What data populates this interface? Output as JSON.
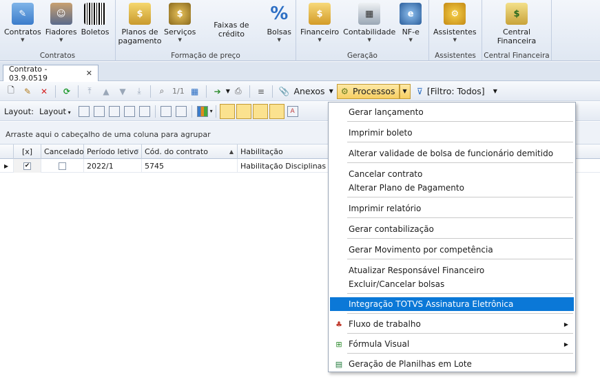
{
  "ribbon": {
    "groups": [
      {
        "label": "Contratos",
        "buttons": [
          {
            "label": "Contratos",
            "icon": "contract-icon",
            "dropdown": true
          },
          {
            "label": "Fiadores",
            "icon": "guarantor-icon",
            "dropdown": true
          },
          {
            "label": "Boletos",
            "icon": "barcode-icon",
            "dropdown": false
          }
        ]
      },
      {
        "label": "Formação de preço",
        "buttons": [
          {
            "label": "Planos de pagamento",
            "icon": "payment-plan-icon",
            "dropdown": false
          },
          {
            "label": "Serviços",
            "icon": "money-bag-icon",
            "dropdown": true
          },
          {
            "label": "Faixas de crédito",
            "icon": "",
            "dropdown": false
          },
          {
            "label": "Bolsas",
            "icon": "percent-icon",
            "dropdown": true
          }
        ]
      },
      {
        "label": "Geração",
        "buttons": [
          {
            "label": "Financeiro",
            "icon": "cash-icon",
            "dropdown": true
          },
          {
            "label": "Contabilidade",
            "icon": "ledger-icon",
            "dropdown": true
          },
          {
            "label": "NF-e",
            "icon": "nfe-icon",
            "dropdown": true
          }
        ]
      },
      {
        "label": "Assistentes",
        "buttons": [
          {
            "label": "Assistentes",
            "icon": "gears-icon",
            "dropdown": true
          }
        ]
      },
      {
        "label": "Central Financeira",
        "buttons": [
          {
            "label": "Central Financeira",
            "icon": "finance-folder-icon",
            "dropdown": false
          }
        ]
      }
    ]
  },
  "tab": {
    "title": "Contrato - 03.9.0519",
    "close": "✕"
  },
  "toolbar": {
    "record_nav": "1/1",
    "anexos": "Anexos",
    "processos": "Processos",
    "filtro": "[Filtro: Todos]"
  },
  "toolbar2": {
    "layout_label": "Layout:",
    "layout_btn": "Layout"
  },
  "group_panel": "Arraste aqui o cabeçalho de uma coluna para agrupar",
  "grid": {
    "columns": [
      "[x]",
      "Cancelado",
      "Período letivo",
      "Cód. do contrato",
      "Habilitação"
    ],
    "rows": [
      {
        "selected": true,
        "cancelado": false,
        "periodo": "2022/1",
        "codigo": "5745",
        "habilitacao": "Habilitação Disciplinas Créd"
      }
    ]
  },
  "menu": {
    "items": [
      {
        "label": "Gerar lançamento"
      },
      {
        "label": "Imprimir boleto"
      },
      {
        "label": "Alterar validade de bolsa de funcionário demitido"
      },
      {
        "label": "Cancelar contrato"
      },
      {
        "label": "Alterar Plano de Pagamento"
      },
      {
        "label": "Imprimir relatório"
      },
      {
        "label": "Gerar contabilização"
      },
      {
        "label": "Gerar Movimento por competência"
      },
      {
        "label": "Atualizar Responsável Financeiro"
      },
      {
        "label": "Excluir/Cancelar bolsas"
      },
      {
        "label": "Integração TOTVS Assinatura Eletrônica",
        "highlighted": true
      },
      {
        "label": "Fluxo de trabalho",
        "icon": "workflow-icon",
        "submenu": true
      },
      {
        "label": "Fórmula Visual",
        "icon": "formula-visual-icon",
        "submenu": true
      },
      {
        "label": "Geração de Planilhas em Lote",
        "icon": "spreadsheet-icon"
      }
    ]
  },
  "colors": {
    "highlight": "#0b78d7",
    "ribbon_bg": "#e4ebf5",
    "active_button": "#f7cf62"
  }
}
